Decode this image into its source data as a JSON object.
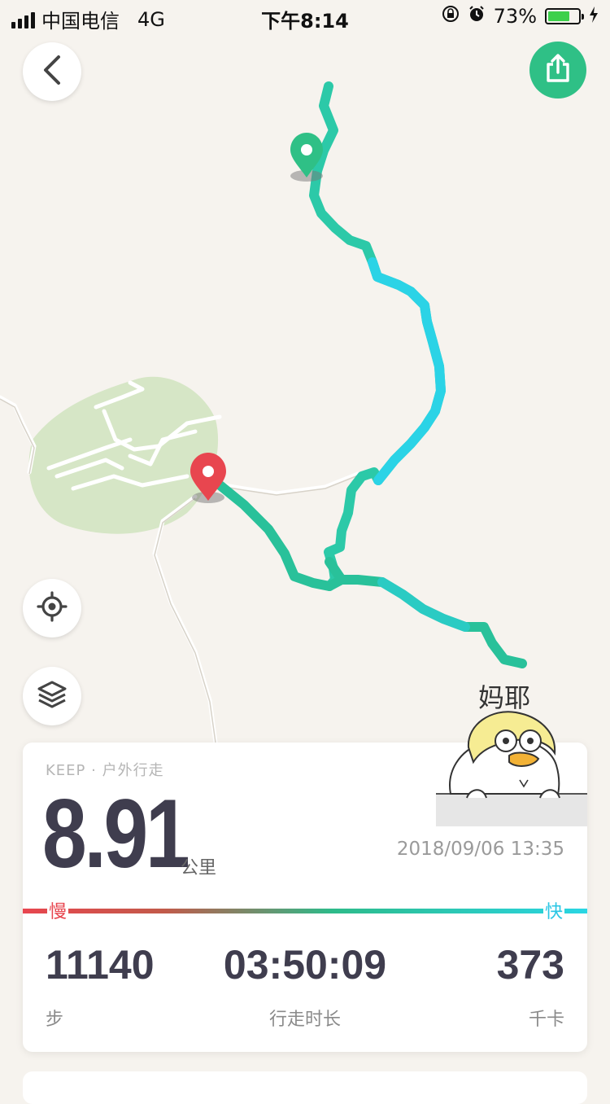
{
  "status_bar": {
    "carrier": "中国电信",
    "network": "4G",
    "time": "下午8:14",
    "battery_percent": "73%",
    "battery_level": 0.73
  },
  "map": {
    "start_marker_color": "#2fc086",
    "end_marker_color": "#e8464f",
    "route_colors": [
      "#28c6a0",
      "#2bd3e6"
    ],
    "park_color": "#d6e6c6"
  },
  "buttons": {
    "back_icon": "chevron-left-icon",
    "share_icon": "share-icon",
    "locate_icon": "crosshair-icon",
    "layers_icon": "layers-icon"
  },
  "sticker": {
    "text": "妈耶"
  },
  "summary": {
    "source": "KEEP · 户外行走",
    "distance": "8.91",
    "distance_unit": "公里",
    "datetime": "2018/09/06 13:35",
    "speed_slow_label": "慢",
    "speed_fast_label": "快",
    "stats": [
      {
        "value": "11140",
        "label": "步"
      },
      {
        "value": "03:50:09",
        "label": "行走时长"
      },
      {
        "value": "373",
        "label": "千卡"
      }
    ]
  },
  "colors": {
    "accent": "#2fc086",
    "slow": "#e8464f",
    "fast": "#2ad6e4",
    "text_dark": "#3f3d4e"
  }
}
